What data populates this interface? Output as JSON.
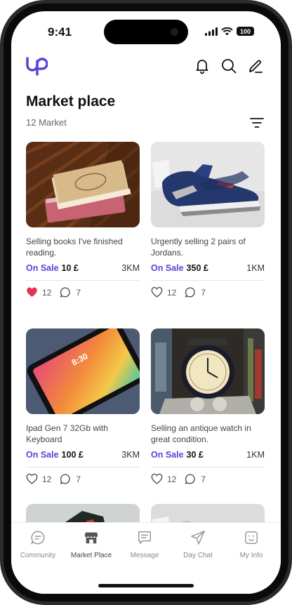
{
  "status_bar": {
    "time": "9:41",
    "battery": "100"
  },
  "header": {
    "title": "Market place",
    "subtitle": "12 Market"
  },
  "items": [
    {
      "desc": "Selling books I've finished reading.",
      "sale": "On Sale",
      "price": "10 £",
      "distance": "3KM",
      "likes": "12",
      "comments": "7",
      "liked": true
    },
    {
      "desc": "Urgently selling 2 pairs of Jordans.",
      "sale": "On Sale",
      "price": "350 £",
      "distance": "1KM",
      "likes": "12",
      "comments": "7",
      "liked": false
    },
    {
      "desc": "Ipad Gen 7 32Gb with Keyboard",
      "sale": "On Sale",
      "price": "100 £",
      "distance": "3KM",
      "likes": "12",
      "comments": "7",
      "liked": false
    },
    {
      "desc": "Selling an antique watch in great condition.",
      "sale": "On Sale",
      "price": "30 £",
      "distance": "1KM",
      "likes": "12",
      "comments": "7",
      "liked": false
    }
  ],
  "ipad_time": "8:30",
  "tabs": [
    {
      "label": "Community"
    },
    {
      "label": "Market Place",
      "active": true
    },
    {
      "label": "Message"
    },
    {
      "label": "Day Chat"
    },
    {
      "label": "My Info"
    }
  ],
  "colors": {
    "accent": "#5A43D6",
    "heart": "#E5305A"
  }
}
